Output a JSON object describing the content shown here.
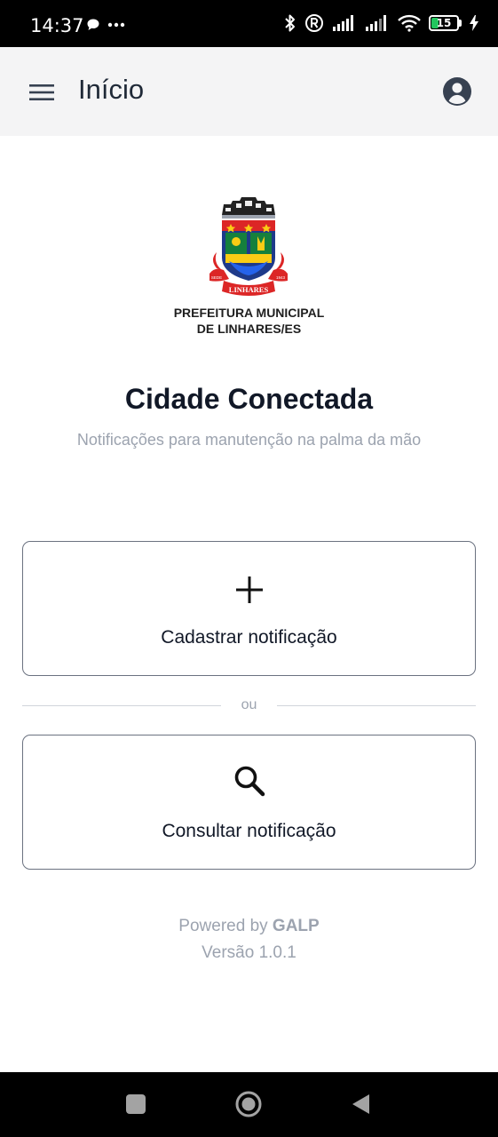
{
  "status_bar": {
    "time": "14:37",
    "left_icons": [
      "chat-bubble-icon",
      "more-dots-icon"
    ],
    "right_icons": [
      "bluetooth-icon",
      "registered-icon",
      "signal-icon",
      "signal-icon",
      "wifi-icon",
      "battery-icon",
      "charging-icon"
    ],
    "battery_level": "15",
    "battery_color": "#22c55e"
  },
  "app_bar": {
    "title": "Início",
    "menu_icon": "hamburger-menu-icon",
    "account_icon": "account-circle-icon"
  },
  "logo": {
    "crest_text": "LINHARES",
    "crest_year_left": "SEDE",
    "crest_year_right": "1943",
    "caption_line1": "PREFEITURA MUNICIPAL",
    "caption_line2": "DE LINHARES/ES"
  },
  "main": {
    "title": "Cidade Conectada",
    "subtitle": "Notificações para manutenção na palma da mão",
    "actions": [
      {
        "icon": "plus-icon",
        "label": "Cadastrar notificação"
      },
      {
        "icon": "search-icon",
        "label": "Consultar notificação"
      }
    ],
    "divider_text": "ou"
  },
  "footer": {
    "powered_prefix": "Powered by",
    "powered_brand": "GALP",
    "version": "Versão 1.0.1"
  },
  "nav_bar": {
    "buttons": [
      "recents-square-icon",
      "home-circle-icon",
      "back-triangle-icon"
    ]
  },
  "colors": {
    "app_bar_bg": "#f4f4f5",
    "title_text": "#111827",
    "muted_text": "#9ca3af",
    "card_border": "#6b7280"
  }
}
